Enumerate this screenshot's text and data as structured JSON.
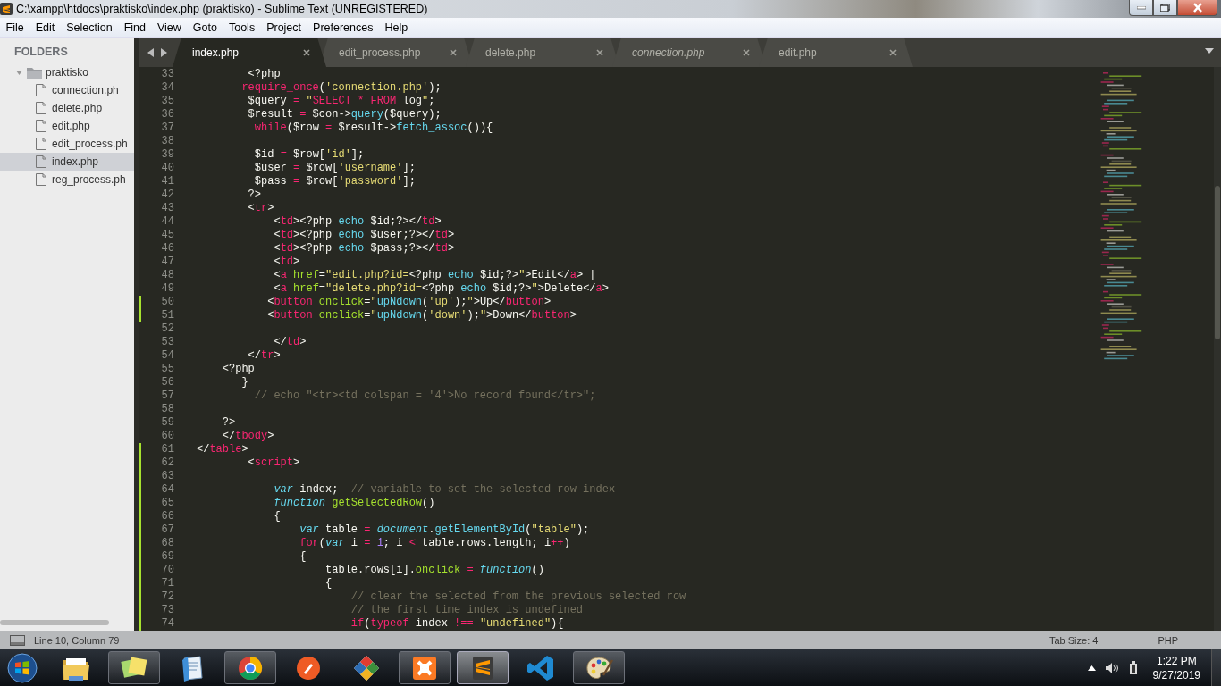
{
  "window": {
    "title": "C:\\xampp\\htdocs\\praktisko\\index.php (praktisko) - Sublime Text (UNREGISTERED)"
  },
  "menu": [
    "File",
    "Edit",
    "Selection",
    "Find",
    "View",
    "Goto",
    "Tools",
    "Project",
    "Preferences",
    "Help"
  ],
  "sidebar": {
    "heading": "FOLDERS",
    "folder": {
      "name": "praktisko",
      "expanded": true,
      "children": [
        {
          "name": "connection.ph",
          "selected": false
        },
        {
          "name": "delete.php",
          "selected": false
        },
        {
          "name": "edit.php",
          "selected": false
        },
        {
          "name": "edit_process.ph",
          "selected": false
        },
        {
          "name": "index.php",
          "selected": true
        },
        {
          "name": "reg_process.ph",
          "selected": false
        }
      ]
    }
  },
  "tabs": [
    {
      "label": "index.php",
      "selected": true,
      "preview": false
    },
    {
      "label": "edit_process.php",
      "selected": false,
      "preview": false
    },
    {
      "label": "delete.php",
      "selected": false,
      "preview": false
    },
    {
      "label": "connection.php",
      "selected": false,
      "preview": true
    },
    {
      "label": "edit.php",
      "selected": false,
      "preview": false
    }
  ],
  "editor": {
    "lines": [
      {
        "number": "33",
        "modified": false,
        "tokens": [
          {
            "kind": "plain",
            "t": "        <?php"
          }
        ]
      },
      {
        "number": "34",
        "modified": false,
        "tokens": [
          {
            "kind": "tag",
            "t": "       require_once"
          },
          {
            "kind": "plain",
            "t": "("
          },
          {
            "kind": "string",
            "t": "'connection.php'"
          },
          {
            "kind": "plain",
            "t": ");"
          }
        ]
      },
      {
        "number": "35",
        "modified": false,
        "tokens": [
          {
            "kind": "plain",
            "t": "        $query "
          },
          {
            "kind": "tag",
            "t": "="
          },
          {
            "kind": "string",
            "t": " \""
          },
          {
            "kind": "tag",
            "t": "SELECT * FROM"
          },
          {
            "kind": "plain",
            "t": " log"
          },
          {
            "kind": "string",
            "t": "\""
          },
          {
            "kind": "plain",
            "t": ";"
          }
        ]
      },
      {
        "number": "36",
        "modified": false,
        "tokens": [
          {
            "kind": "plain",
            "t": "        $result "
          },
          {
            "kind": "tag",
            "t": "="
          },
          {
            "kind": "plain",
            "t": " $con->"
          },
          {
            "kind": "call",
            "t": "query"
          },
          {
            "kind": "plain",
            "t": "($query);"
          }
        ]
      },
      {
        "number": "37",
        "modified": false,
        "tokens": [
          {
            "kind": "tag",
            "t": "         while"
          },
          {
            "kind": "plain",
            "t": "($row "
          },
          {
            "kind": "tag",
            "t": "="
          },
          {
            "kind": "plain",
            "t": " $result->"
          },
          {
            "kind": "call",
            "t": "fetch_assoc"
          },
          {
            "kind": "plain",
            "t": "()){"
          }
        ]
      },
      {
        "number": "38",
        "modified": false
      },
      {
        "number": "39",
        "modified": false,
        "tokens": [
          {
            "kind": "plain",
            "t": "         $id "
          },
          {
            "kind": "tag",
            "t": "="
          },
          {
            "kind": "plain",
            "t": " $row["
          },
          {
            "kind": "string",
            "t": "'id'"
          },
          {
            "kind": "plain",
            "t": "];"
          }
        ]
      },
      {
        "number": "40",
        "modified": false,
        "tokens": [
          {
            "kind": "plain",
            "t": "         $user "
          },
          {
            "kind": "tag",
            "t": "="
          },
          {
            "kind": "plain",
            "t": " $row["
          },
          {
            "kind": "string",
            "t": "'username'"
          },
          {
            "kind": "plain",
            "t": "];"
          }
        ]
      },
      {
        "number": "41",
        "modified": false,
        "tokens": [
          {
            "kind": "plain",
            "t": "         $pass "
          },
          {
            "kind": "tag",
            "t": "="
          },
          {
            "kind": "plain",
            "t": " $row["
          },
          {
            "kind": "string",
            "t": "'password'"
          },
          {
            "kind": "plain",
            "t": "];"
          }
        ]
      },
      {
        "number": "42",
        "modified": false,
        "tokens": [
          {
            "kind": "plain",
            "t": "        ?>"
          }
        ]
      },
      {
        "number": "43",
        "modified": false,
        "tokens": [
          {
            "kind": "plain",
            "t": "        <"
          },
          {
            "kind": "tag",
            "t": "tr"
          },
          {
            "kind": "plain",
            "t": ">"
          }
        ]
      },
      {
        "number": "44",
        "modified": false,
        "tokens": [
          {
            "kind": "plain",
            "t": "            <"
          },
          {
            "kind": "tag",
            "t": "td"
          },
          {
            "kind": "plain",
            "t": "><?php "
          },
          {
            "kind": "call",
            "t": "echo"
          },
          {
            "kind": "plain",
            "t": " $id;?></"
          },
          {
            "kind": "tag",
            "t": "td"
          },
          {
            "kind": "plain",
            "t": ">"
          }
        ]
      },
      {
        "number": "45",
        "modified": false,
        "tokens": [
          {
            "kind": "plain",
            "t": "            <"
          },
          {
            "kind": "tag",
            "t": "td"
          },
          {
            "kind": "plain",
            "t": "><?php "
          },
          {
            "kind": "call",
            "t": "echo"
          },
          {
            "kind": "plain",
            "t": " $user;?></"
          },
          {
            "kind": "tag",
            "t": "td"
          },
          {
            "kind": "plain",
            "t": ">"
          }
        ]
      },
      {
        "number": "46",
        "modified": false,
        "tokens": [
          {
            "kind": "plain",
            "t": "            <"
          },
          {
            "kind": "tag",
            "t": "td"
          },
          {
            "kind": "plain",
            "t": "><?php "
          },
          {
            "kind": "call",
            "t": "echo"
          },
          {
            "kind": "plain",
            "t": " $pass;?></"
          },
          {
            "kind": "tag",
            "t": "td"
          },
          {
            "kind": "plain",
            "t": ">"
          }
        ]
      },
      {
        "number": "47",
        "modified": false,
        "tokens": [
          {
            "kind": "plain",
            "t": "            <"
          },
          {
            "kind": "tag",
            "t": "td"
          },
          {
            "kind": "plain",
            "t": ">"
          }
        ]
      },
      {
        "number": "48",
        "modified": false,
        "tokens": [
          {
            "kind": "plain",
            "t": "            <"
          },
          {
            "kind": "tag",
            "t": "a"
          },
          {
            "kind": "attr",
            "t": " href"
          },
          {
            "kind": "plain",
            "t": "="
          },
          {
            "kind": "string",
            "t": "\"edit.php?id="
          },
          {
            "kind": "plain",
            "t": "<?php "
          },
          {
            "kind": "call",
            "t": "echo"
          },
          {
            "kind": "plain",
            "t": " $id;?>"
          },
          {
            "kind": "string",
            "t": "\""
          },
          {
            "kind": "plain",
            "t": ">Edit</"
          },
          {
            "kind": "tag",
            "t": "a"
          },
          {
            "kind": "plain",
            "t": "> |"
          }
        ]
      },
      {
        "number": "49",
        "modified": false,
        "tokens": [
          {
            "kind": "plain",
            "t": "            <"
          },
          {
            "kind": "tag",
            "t": "a"
          },
          {
            "kind": "attr",
            "t": " href"
          },
          {
            "kind": "plain",
            "t": "="
          },
          {
            "kind": "string",
            "t": "\"delete.php?id="
          },
          {
            "kind": "plain",
            "t": "<?php "
          },
          {
            "kind": "call",
            "t": "echo"
          },
          {
            "kind": "plain",
            "t": " $id;?>"
          },
          {
            "kind": "string",
            "t": "\""
          },
          {
            "kind": "plain",
            "t": ">Delete</"
          },
          {
            "kind": "tag",
            "t": "a"
          },
          {
            "kind": "plain",
            "t": ">"
          }
        ]
      },
      {
        "number": "50",
        "modified": true,
        "tokens": [
          {
            "kind": "plain",
            "t": "           <"
          },
          {
            "kind": "tag",
            "t": "button"
          },
          {
            "kind": "attr",
            "t": " onclick"
          },
          {
            "kind": "plain",
            "t": "="
          },
          {
            "kind": "string",
            "t": "\""
          },
          {
            "kind": "call",
            "t": "upNdown"
          },
          {
            "kind": "plain",
            "t": "("
          },
          {
            "kind": "string",
            "t": "'up'"
          },
          {
            "kind": "plain",
            "t": ");"
          },
          {
            "kind": "string",
            "t": "\""
          },
          {
            "kind": "plain",
            "t": ">Up</"
          },
          {
            "kind": "tag",
            "t": "button"
          },
          {
            "kind": "plain",
            "t": ">"
          }
        ]
      },
      {
        "number": "51",
        "modified": true,
        "tokens": [
          {
            "kind": "plain",
            "t": "           <"
          },
          {
            "kind": "tag",
            "t": "button"
          },
          {
            "kind": "attr",
            "t": " onclick"
          },
          {
            "kind": "plain",
            "t": "="
          },
          {
            "kind": "string",
            "t": "\""
          },
          {
            "kind": "call",
            "t": "upNdown"
          },
          {
            "kind": "plain",
            "t": "("
          },
          {
            "kind": "string",
            "t": "'down'"
          },
          {
            "kind": "plain",
            "t": ");"
          },
          {
            "kind": "string",
            "t": "\""
          },
          {
            "kind": "plain",
            "t": ">Down</"
          },
          {
            "kind": "tag",
            "t": "button"
          },
          {
            "kind": "plain",
            "t": ">"
          }
        ]
      },
      {
        "number": "52",
        "modified": false
      },
      {
        "number": "53",
        "modified": false,
        "tokens": [
          {
            "kind": "plain",
            "t": "            </"
          },
          {
            "kind": "tag",
            "t": "td"
          },
          {
            "kind": "plain",
            "t": ">"
          }
        ]
      },
      {
        "number": "54",
        "modified": false,
        "tokens": [
          {
            "kind": "plain",
            "t": "        </"
          },
          {
            "kind": "tag",
            "t": "tr"
          },
          {
            "kind": "plain",
            "t": ">"
          }
        ]
      },
      {
        "number": "55",
        "modified": false,
        "tokens": [
          {
            "kind": "plain",
            "t": "    <?php"
          }
        ]
      },
      {
        "number": "56",
        "modified": false,
        "tokens": [
          {
            "kind": "plain",
            "t": "       }"
          }
        ]
      },
      {
        "number": "57",
        "modified": false,
        "tokens": [
          {
            "kind": "comment",
            "t": "         // echo \"<tr><td colspan = '4'>No record found</tr>\";"
          }
        ]
      },
      {
        "number": "58",
        "modified": false
      },
      {
        "number": "59",
        "modified": false,
        "tokens": [
          {
            "kind": "plain",
            "t": "    ?>"
          }
        ]
      },
      {
        "number": "60",
        "modified": false,
        "tokens": [
          {
            "kind": "plain",
            "t": "    </"
          },
          {
            "kind": "tag",
            "t": "tbody"
          },
          {
            "kind": "plain",
            "t": ">"
          }
        ]
      },
      {
        "number": "61",
        "modified": true,
        "tokens": [
          {
            "kind": "plain",
            "t": "</"
          },
          {
            "kind": "tag",
            "t": "table"
          },
          {
            "kind": "plain",
            "t": ">"
          }
        ]
      },
      {
        "number": "62",
        "modified": true,
        "tokens": [
          {
            "kind": "plain",
            "t": "        <"
          },
          {
            "kind": "tag",
            "t": "script"
          },
          {
            "kind": "plain",
            "t": ">"
          }
        ]
      },
      {
        "number": "63",
        "modified": true
      },
      {
        "number": "64",
        "modified": true,
        "tokens": [
          {
            "kind": "storage",
            "t": "            var"
          },
          {
            "kind": "plain",
            "t": " index;"
          },
          {
            "kind": "comment",
            "t": "  // variable to set the selected row index"
          }
        ]
      },
      {
        "number": "65",
        "modified": true,
        "tokens": [
          {
            "kind": "storage",
            "t": "            function"
          },
          {
            "kind": "attr",
            "t": " getSelectedRow"
          },
          {
            "kind": "plain",
            "t": "()"
          }
        ]
      },
      {
        "number": "66",
        "modified": true,
        "tokens": [
          {
            "kind": "plain",
            "t": "            {"
          }
        ]
      },
      {
        "number": "67",
        "modified": true,
        "tokens": [
          {
            "kind": "storage",
            "t": "                var"
          },
          {
            "kind": "plain",
            "t": " table "
          },
          {
            "kind": "tag",
            "t": "="
          },
          {
            "kind": "storage",
            "t": " document"
          },
          {
            "kind": "plain",
            "t": "."
          },
          {
            "kind": "call",
            "t": "getElementById"
          },
          {
            "kind": "plain",
            "t": "("
          },
          {
            "kind": "string",
            "t": "\"table\""
          },
          {
            "kind": "plain",
            "t": ");"
          }
        ]
      },
      {
        "number": "68",
        "modified": true,
        "tokens": [
          {
            "kind": "tag",
            "t": "                for"
          },
          {
            "kind": "plain",
            "t": "("
          },
          {
            "kind": "storage",
            "t": "var"
          },
          {
            "kind": "plain",
            "t": " i "
          },
          {
            "kind": "tag",
            "t": "="
          },
          {
            "kind": "number",
            "t": " 1"
          },
          {
            "kind": "plain",
            "t": "; i "
          },
          {
            "kind": "tag",
            "t": "<"
          },
          {
            "kind": "plain",
            "t": " table.rows.length; i"
          },
          {
            "kind": "tag",
            "t": "++"
          },
          {
            "kind": "plain",
            "t": ")"
          }
        ]
      },
      {
        "number": "69",
        "modified": true,
        "tokens": [
          {
            "kind": "plain",
            "t": "                {"
          }
        ]
      },
      {
        "number": "70",
        "modified": true,
        "tokens": [
          {
            "kind": "plain",
            "t": "                    table.rows[i]."
          },
          {
            "kind": "attr",
            "t": "onclick"
          },
          {
            "kind": "tag",
            "t": " ="
          },
          {
            "kind": "storage",
            "t": " function"
          },
          {
            "kind": "plain",
            "t": "()"
          }
        ]
      },
      {
        "number": "71",
        "modified": true,
        "tokens": [
          {
            "kind": "plain",
            "t": "                    {"
          }
        ]
      },
      {
        "number": "72",
        "modified": true,
        "tokens": [
          {
            "kind": "comment",
            "t": "                        // clear the selected from the previous selected row"
          }
        ]
      },
      {
        "number": "73",
        "modified": true,
        "tokens": [
          {
            "kind": "comment",
            "t": "                        // the first time index is undefined"
          }
        ]
      },
      {
        "number": "74",
        "modified": true,
        "tokens": [
          {
            "kind": "tag",
            "t": "                        if"
          },
          {
            "kind": "plain",
            "t": "("
          },
          {
            "kind": "tag",
            "t": "typeof"
          },
          {
            "kind": "plain",
            "t": " index "
          },
          {
            "kind": "tag",
            "t": "!=="
          },
          {
            "kind": "string",
            "t": " \"undefined\""
          },
          {
            "kind": "plain",
            "t": "){"
          }
        ]
      }
    ]
  },
  "status_bar": {
    "position": "Line 10, Column 79",
    "tab_size": "Tab Size: 4",
    "syntax": "PHP"
  },
  "taskbar": {
    "apps": [
      {
        "kind": "folder",
        "running": false,
        "selected": false
      },
      {
        "kind": "notes",
        "running": true,
        "selected": false
      },
      {
        "kind": "pad",
        "running": false,
        "selected": false
      },
      {
        "kind": "ring",
        "running": true,
        "selected": false
      },
      {
        "kind": "orb",
        "running": false,
        "selected": false
      },
      {
        "kind": "diamond",
        "running": false,
        "selected": false
      },
      {
        "kind": "knot",
        "running": true,
        "selected": false
      },
      {
        "kind": "bars",
        "running": true,
        "selected": true
      },
      {
        "kind": "ribbon",
        "running": false,
        "selected": false
      },
      {
        "kind": "palette",
        "running": true,
        "selected": false
      }
    ],
    "time": "1:22 PM",
    "date": "9/27/2019"
  }
}
